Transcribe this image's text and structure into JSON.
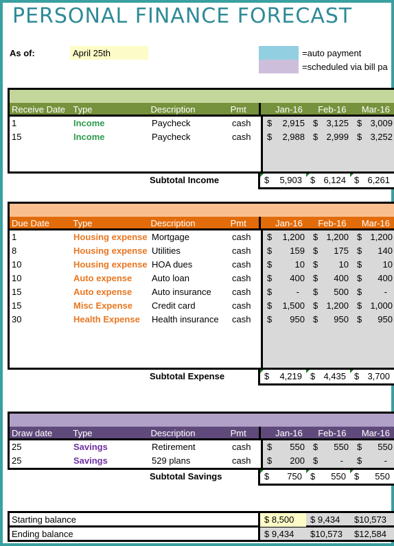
{
  "title": "PERSONAL FINANCE FORECAST",
  "as_of": {
    "label": "As of:",
    "value": "April 25th"
  },
  "legend": [
    {
      "color": "#92cfe0",
      "label": "=auto payment"
    },
    {
      "color": "#cdbfdb",
      "label": "=scheduled via bill pa"
    }
  ],
  "months": [
    "Jan-16",
    "Feb-16",
    "Mar-16"
  ],
  "income": {
    "band_color": "#c4d79b",
    "header_color": "#76923c",
    "type_color": "#2e9b4e",
    "headers": [
      "Receive Date",
      "Type",
      "Description",
      "Pmt"
    ],
    "rows": [
      {
        "date": "1",
        "type": "Income",
        "description": "Paycheck",
        "pmt": "cash",
        "values": [
          "2,915",
          "3,125",
          "3,009"
        ]
      },
      {
        "date": "15",
        "type": "Income",
        "description": "Paycheck",
        "pmt": "cash",
        "values": [
          "2,988",
          "2,999",
          "3,252"
        ]
      }
    ],
    "subtotal_label": "Subtotal Income",
    "subtotals": [
      "5,903",
      "6,124",
      "6,261"
    ]
  },
  "expense": {
    "band_color": "#fabf8f",
    "header_color": "#e26b0a",
    "type_color": "#e87722",
    "headers": [
      "Due Date",
      "Type",
      "Description",
      "Pmt"
    ],
    "rows": [
      {
        "date": "1",
        "type": "Housing expense",
        "description": "Mortgage",
        "pmt": "cash",
        "values": [
          "1,200",
          "1,200",
          "1,200"
        ]
      },
      {
        "date": "8",
        "type": "Housing expense",
        "description": "Utilities",
        "pmt": "cash",
        "values": [
          "159",
          "175",
          "140"
        ]
      },
      {
        "date": "10",
        "type": "Housing expense",
        "description": "HOA dues",
        "pmt": "cash",
        "values": [
          "10",
          "10",
          "10"
        ]
      },
      {
        "date": "10",
        "type": "Auto expense",
        "description": "Auto loan",
        "pmt": "cash",
        "values": [
          "400",
          "400",
          "400"
        ]
      },
      {
        "date": "15",
        "type": "Auto expense",
        "description": "Auto insurance",
        "pmt": "cash",
        "values": [
          "-",
          "500",
          "-"
        ]
      },
      {
        "date": "15",
        "type": "Misc Expense",
        "description": "Credit card",
        "pmt": "cash",
        "values": [
          "1,500",
          "1,200",
          "1,000"
        ]
      },
      {
        "date": "30",
        "type": "Health Expense",
        "description": "Health insurance",
        "pmt": "cash",
        "values": [
          "950",
          "950",
          "950"
        ]
      }
    ],
    "subtotal_label": "Subtotal Expense",
    "subtotals": [
      "4,219",
      "4,435",
      "3,700"
    ]
  },
  "savings": {
    "band_color": "#b1a0c7",
    "header_color": "#604a7b",
    "type_color": "#7030a0",
    "headers": [
      "Draw date",
      "Type",
      "Description",
      "Pmt"
    ],
    "rows": [
      {
        "date": "25",
        "type": "Savings",
        "description": "Retirement",
        "pmt": "cash",
        "values": [
          "550",
          "550",
          "550"
        ]
      },
      {
        "date": "25",
        "type": "Savings",
        "description": "529 plans",
        "pmt": "cash",
        "values": [
          "200",
          "-",
          "-"
        ]
      }
    ],
    "subtotal_label": "Subtotal Savings",
    "subtotals": [
      "750",
      "550",
      "550"
    ]
  },
  "balances": [
    {
      "label": "Starting balance",
      "values": [
        "$  8,500",
        "$  9,434",
        "$10,573"
      ]
    },
    {
      "label": "Ending balance",
      "values": [
        "$  9,434",
        "$10,573",
        "$12,584"
      ]
    }
  ],
  "currency": "$"
}
